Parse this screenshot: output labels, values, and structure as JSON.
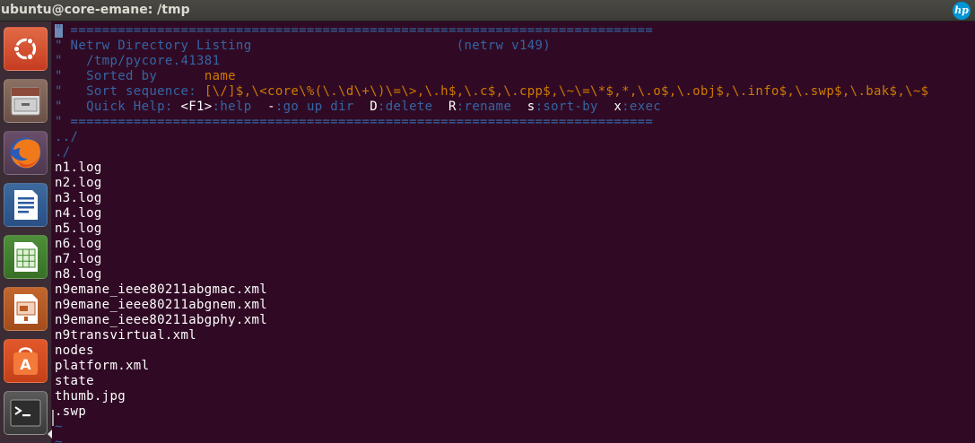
{
  "window": {
    "title": "ubuntu@core-emane: /tmp",
    "brand": "hp"
  },
  "launcher": [
    {
      "name": "ubuntu-dash-icon",
      "label": "Search your computer"
    },
    {
      "name": "files-icon",
      "label": "Files"
    },
    {
      "name": "firefox-icon",
      "label": "Firefox Web Browser"
    },
    {
      "name": "writer-icon",
      "label": "LibreOffice Writer"
    },
    {
      "name": "calc-icon",
      "label": "LibreOffice Calc"
    },
    {
      "name": "impress-icon",
      "label": "LibreOffice Impress"
    },
    {
      "name": "software-center-icon",
      "label": "Ubuntu Software"
    },
    {
      "name": "terminal-icon",
      "label": "Terminal"
    }
  ],
  "netrw": {
    "cursor_char": "\"",
    "rule": " ==========================================================================",
    "title": " Netrw Directory Listing",
    "version": "(netrw v149)",
    "path": "   /tmp/pycore.41381",
    "sorted_label": "   Sorted by      ",
    "sorted_value": "name",
    "sortseq_label": "   Sort sequence: ",
    "sortseq_value": "[\\/]$,\\<core\\%(\\.\\d\\+\\)\\=\\>,\\.h$,\\.c$,\\.cpp$,\\~\\=\\*$,*,\\.o$,\\.obj$,\\.info$,\\.swp$,\\.bak$,\\~$",
    "quickhelp_label": "   Quick Help: ",
    "help": {
      "f1_key": "<F1>",
      "f1_desc": ":help",
      "up_key": "-",
      "up_desc": ":go up dir",
      "del_key": "D",
      "del_desc": ":delete",
      "ren_key": "R",
      "ren_desc": ":rename",
      "sort_key": "s",
      "sort_desc": ":sort-by",
      "exec_key": "x",
      "exec_desc": ":exec"
    }
  },
  "dirs": [
    "../",
    "./"
  ],
  "files": [
    "n1.log",
    "n2.log",
    "n3.log",
    "n4.log",
    "n5.log",
    "n6.log",
    "n7.log",
    "n8.log",
    "n9emane_ieee80211abgmac.xml",
    "n9emane_ieee80211abgnem.xml",
    "n9emane_ieee80211abgphy.xml",
    "n9transvirtual.xml",
    "nodes",
    "platform.xml",
    "state",
    "thumb.jpg",
    ".swp"
  ],
  "tilde": "~",
  "colors": {
    "terminal_bg": "#300a24",
    "comment": "#3465a4",
    "value": "#ce7a00",
    "text": "#ffffff",
    "launcher_bg": "#3b2c35",
    "panel_bg": "#3c3b37"
  }
}
